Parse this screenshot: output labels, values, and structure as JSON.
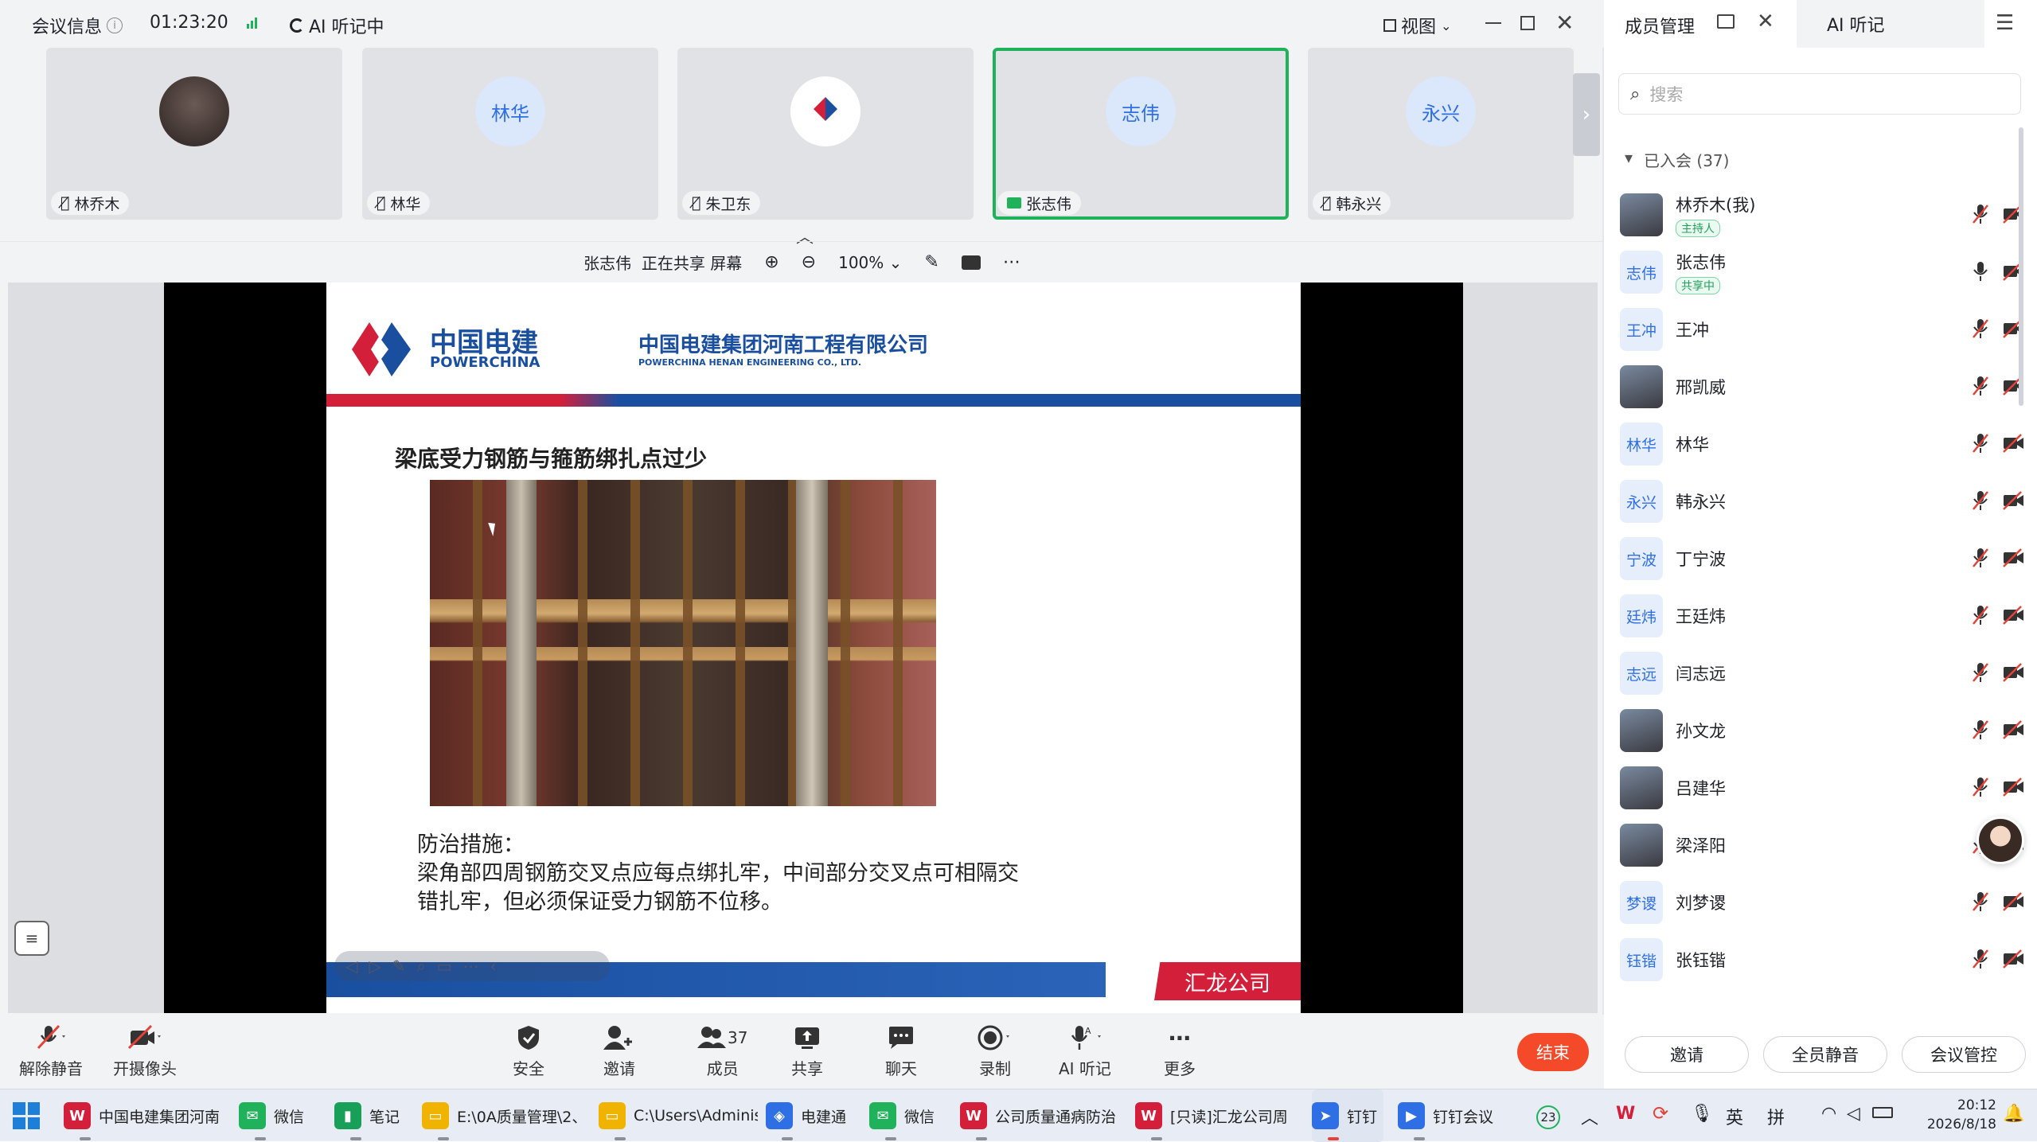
{
  "topbar": {
    "meeting_info": "会议信息",
    "timer": "01:23:20",
    "ai_status": "AI 听记中",
    "view_label": "视图"
  },
  "thumbs": [
    {
      "name": "林乔木",
      "avatar_text": ""
    },
    {
      "name": "林华",
      "avatar_text": "林华"
    },
    {
      "name": "朱卫东",
      "avatar_text": ""
    },
    {
      "name": "张志伟",
      "avatar_text": "志伟",
      "active": true
    },
    {
      "name": "韩永兴",
      "avatar_text": "永兴"
    }
  ],
  "sharebar": {
    "presenter": "张志伟",
    "status": "正在共享 屏幕",
    "zoom": "100%"
  },
  "slide": {
    "company_cn": "中国电建",
    "company_en": "POWERCHINA",
    "header_title": "中国电建集团河南工程有限公司",
    "header_subtitle": "POWERCHINA HENAN ENGINEERING CO., LTD.",
    "heading": "梁底受力钢筋与箍筋绑扎点过少",
    "measures_label": "防治措施：",
    "measures_line1": "梁角部四周钢筋交叉点应每点绑扎牢，中间部分交叉点可相隔交",
    "measures_line2": "错扎牢，但必须保证受力钢筋不位移。",
    "footer_tag": "汇龙公司"
  },
  "bottombar": {
    "unmute": "解除静音",
    "camera": "开摄像头",
    "security": "安全",
    "invite": "邀请",
    "members": "成员",
    "members_count": "37",
    "share": "共享",
    "chat": "聊天",
    "record": "录制",
    "ai_notes": "AI 听记",
    "more": "更多",
    "end": "结束"
  },
  "side": {
    "tab_members": "成员管理",
    "tab_ai": "AI 听记",
    "search_placeholder": "搜索",
    "joined_label": "已入会 (37)",
    "members": [
      {
        "name": "林乔木(我)",
        "tag": "主持人",
        "avatar": "",
        "photo": true
      },
      {
        "name": "张志伟",
        "tag": "共享中",
        "avatar": "志伟",
        "mic_on": true
      },
      {
        "name": "王冲",
        "avatar": "王冲"
      },
      {
        "name": "邢凯威",
        "avatar": "",
        "photo": true
      },
      {
        "name": "林华",
        "avatar": "林华"
      },
      {
        "name": "韩永兴",
        "avatar": "永兴"
      },
      {
        "name": "丁宁波",
        "avatar": "宁波"
      },
      {
        "name": "王廷炜",
        "avatar": "廷炜"
      },
      {
        "name": "闫志远",
        "avatar": "志远"
      },
      {
        "name": "孙文龙",
        "avatar": "",
        "photo": true
      },
      {
        "name": "吕建华",
        "avatar": "",
        "photo": true
      },
      {
        "name": "梁泽阳",
        "avatar": "",
        "photo": true
      },
      {
        "name": "刘梦谡",
        "avatar": "梦谡"
      },
      {
        "name": "张钰锴",
        "avatar": "钰锴"
      }
    ],
    "btn_invite": "邀请",
    "btn_mute_all": "全员静音",
    "btn_control": "会议管控"
  },
  "taskbar": {
    "items": [
      "中国电建集团河南",
      "微信",
      "笔记",
      "E:\\0A质量管理\\2、",
      "C:\\Users\\Adminis",
      "电建通",
      "微信",
      "公司质量通病防治",
      "[只读]汇龙公司周",
      "钉钉",
      "钉钉会议"
    ],
    "badge": "23",
    "ime1": "英",
    "ime2": "拼",
    "time": "20:12",
    "date": "2026/8/18"
  },
  "colors": {
    "accent": "#2f6fe6",
    "green": "#20b25a",
    "end": "#f54a2a",
    "brand_red": "#d41f3a",
    "brand_blue": "#1a4fa0"
  }
}
